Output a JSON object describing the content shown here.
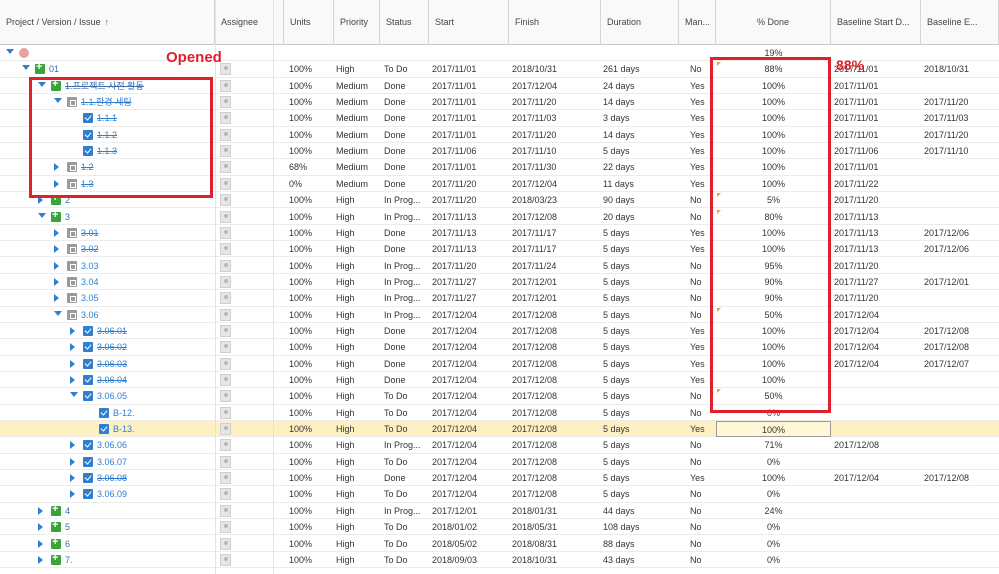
{
  "columns": [
    {
      "label": "Project / Version / Issue",
      "sort_icon": "↑"
    },
    {
      "label": "Assignee"
    },
    {
      "label": "Units"
    },
    {
      "label": "Priority"
    },
    {
      "label": "Status"
    },
    {
      "label": "Start"
    },
    {
      "label": "Finish"
    },
    {
      "label": "Duration"
    },
    {
      "label": "Man..."
    },
    {
      "label": "% Done"
    },
    {
      "label": "Baseline Start D..."
    },
    {
      "label": "Baseline E..."
    }
  ],
  "root_row": {
    "pct_done": "19%"
  },
  "rows": [
    {
      "name": "01",
      "done": false,
      "units": "100%",
      "priority": "High",
      "status": "To Do",
      "start": "2017/11/01",
      "finish": "2018/10/31",
      "duration": "261 days",
      "manual": "No",
      "pct": "88%",
      "bstart": "2017/11/01",
      "bend": "2018/10/31"
    },
    {
      "name": "1.프로젝트 사전 활동",
      "done": true,
      "units": "100%",
      "priority": "Medium",
      "status": "Done",
      "start": "2017/11/01",
      "finish": "2017/12/04",
      "duration": "24 days",
      "manual": "Yes",
      "pct": "100%",
      "bstart": "2017/11/01",
      "bend": ""
    },
    {
      "name": "1.1.환경 세팅",
      "done": true,
      "units": "100%",
      "priority": "Medium",
      "status": "Done",
      "start": "2017/11/01",
      "finish": "2017/11/20",
      "duration": "14 days",
      "manual": "Yes",
      "pct": "100%",
      "bstart": "2017/11/01",
      "bend": "2017/11/20"
    },
    {
      "name": "1.1.1",
      "done": true,
      "units": "100%",
      "priority": "Medium",
      "status": "Done",
      "start": "2017/11/01",
      "finish": "2017/11/03",
      "duration": "3 days",
      "manual": "Yes",
      "pct": "100%",
      "bstart": "2017/11/01",
      "bend": "2017/11/03"
    },
    {
      "name": "1.1.2",
      "done": true,
      "units": "100%",
      "priority": "Medium",
      "status": "Done",
      "start": "2017/11/01",
      "finish": "2017/11/20",
      "duration": "14 days",
      "manual": "Yes",
      "pct": "100%",
      "bstart": "2017/11/01",
      "bend": "2017/11/20"
    },
    {
      "name": "1.1.3",
      "done": true,
      "units": "100%",
      "priority": "Medium",
      "status": "Done",
      "start": "2017/11/06",
      "finish": "2017/11/10",
      "duration": "5 days",
      "manual": "Yes",
      "pct": "100%",
      "bstart": "2017/11/06",
      "bend": "2017/11/10"
    },
    {
      "name": "1.2",
      "done": true,
      "units": "68%",
      "priority": "Medium",
      "status": "Done",
      "start": "2017/11/01",
      "finish": "2017/11/30",
      "duration": "22 days",
      "manual": "Yes",
      "pct": "100%",
      "bstart": "2017/11/01",
      "bend": ""
    },
    {
      "name": "1.3",
      "done": true,
      "units": "0%",
      "priority": "Medium",
      "status": "Done",
      "start": "2017/11/20",
      "finish": "2017/12/04",
      "duration": "11 days",
      "manual": "Yes",
      "pct": "100%",
      "bstart": "2017/11/22",
      "bend": ""
    },
    {
      "name": "2",
      "done": false,
      "units": "100%",
      "priority": "High",
      "status": "In Prog...",
      "start": "2017/11/20",
      "finish": "2018/03/23",
      "duration": "90 days",
      "manual": "No",
      "pct": "5%",
      "bstart": "2017/11/20",
      "bend": ""
    },
    {
      "name": "3",
      "done": false,
      "units": "100%",
      "priority": "High",
      "status": "In Prog...",
      "start": "2017/11/13",
      "finish": "2017/12/08",
      "duration": "20 days",
      "manual": "No",
      "pct": "80%",
      "bstart": "2017/11/13",
      "bend": ""
    },
    {
      "name": "3.01",
      "done": true,
      "units": "100%",
      "priority": "High",
      "status": "Done",
      "start": "2017/11/13",
      "finish": "2017/11/17",
      "duration": "5 days",
      "manual": "Yes",
      "pct": "100%",
      "bstart": "2017/11/13",
      "bend": "2017/12/06"
    },
    {
      "name": "3.02",
      "done": true,
      "units": "100%",
      "priority": "High",
      "status": "Done",
      "start": "2017/11/13",
      "finish": "2017/11/17",
      "duration": "5 days",
      "manual": "Yes",
      "pct": "100%",
      "bstart": "2017/11/13",
      "bend": "2017/12/06"
    },
    {
      "name": "3.03",
      "done": false,
      "units": "100%",
      "priority": "High",
      "status": "In Prog...",
      "start": "2017/11/20",
      "finish": "2017/11/24",
      "duration": "5 days",
      "manual": "No",
      "pct": "95%",
      "bstart": "2017/11/20",
      "bend": ""
    },
    {
      "name": "3.04",
      "done": false,
      "units": "100%",
      "priority": "High",
      "status": "In Prog...",
      "start": "2017/11/27",
      "finish": "2017/12/01",
      "duration": "5 days",
      "manual": "No",
      "pct": "90%",
      "bstart": "2017/11/27",
      "bend": "2017/12/01"
    },
    {
      "name": "3.05",
      "done": false,
      "units": "100%",
      "priority": "High",
      "status": "In Prog...",
      "start": "2017/11/27",
      "finish": "2017/12/01",
      "duration": "5 days",
      "manual": "No",
      "pct": "90%",
      "bstart": "2017/11/20",
      "bend": ""
    },
    {
      "name": "3.06",
      "done": false,
      "units": "100%",
      "priority": "High",
      "status": "In Prog...",
      "start": "2017/12/04",
      "finish": "2017/12/08",
      "duration": "5 days",
      "manual": "No",
      "pct": "50%",
      "bstart": "2017/12/04",
      "bend": ""
    },
    {
      "name": "3.06.01",
      "done": true,
      "units": "100%",
      "priority": "High",
      "status": "Done",
      "start": "2017/12/04",
      "finish": "2017/12/08",
      "duration": "5 days",
      "manual": "Yes",
      "pct": "100%",
      "bstart": "2017/12/04",
      "bend": "2017/12/08"
    },
    {
      "name": "3.06.02",
      "done": true,
      "units": "100%",
      "priority": "High",
      "status": "Done",
      "start": "2017/12/04",
      "finish": "2017/12/08",
      "duration": "5 days",
      "manual": "Yes",
      "pct": "100%",
      "bstart": "2017/12/04",
      "bend": "2017/12/08"
    },
    {
      "name": "3.06.03",
      "done": true,
      "units": "100%",
      "priority": "High",
      "status": "Done",
      "start": "2017/12/04",
      "finish": "2017/12/08",
      "duration": "5 days",
      "manual": "Yes",
      "pct": "100%",
      "bstart": "2017/12/04",
      "bend": "2017/12/07"
    },
    {
      "name": "3.06.04",
      "done": true,
      "units": "100%",
      "priority": "High",
      "status": "Done",
      "start": "2017/12/04",
      "finish": "2017/12/08",
      "duration": "5 days",
      "manual": "Yes",
      "pct": "100%",
      "bstart": "",
      "bend": ""
    },
    {
      "name": "3.06.05",
      "done": false,
      "units": "100%",
      "priority": "High",
      "status": "To Do",
      "start": "2017/12/04",
      "finish": "2017/12/08",
      "duration": "5 days",
      "manual": "No",
      "pct": "50%",
      "bstart": "",
      "bend": ""
    },
    {
      "name": "B-12.",
      "done": false,
      "units": "100%",
      "priority": "High",
      "status": "To Do",
      "start": "2017/12/04",
      "finish": "2017/12/08",
      "duration": "5 days",
      "manual": "No",
      "pct": "0%",
      "bstart": "",
      "bend": ""
    },
    {
      "name": "B-13.",
      "done": false,
      "units": "100%",
      "priority": "High",
      "status": "To Do",
      "start": "2017/12/04",
      "finish": "2017/12/08",
      "duration": "5 days",
      "manual": "Yes",
      "pct": "100%",
      "bstart": "",
      "bend": ""
    },
    {
      "name": "3.06.06",
      "done": false,
      "units": "100%",
      "priority": "High",
      "status": "In Prog...",
      "start": "2017/12/04",
      "finish": "2017/12/08",
      "duration": "5 days",
      "manual": "No",
      "pct": "71%",
      "bstart": "2017/12/08",
      "bend": ""
    },
    {
      "name": "3.06.07",
      "done": false,
      "units": "100%",
      "priority": "High",
      "status": "To Do",
      "start": "2017/12/04",
      "finish": "2017/12/08",
      "duration": "5 days",
      "manual": "No",
      "pct": "0%",
      "bstart": "",
      "bend": ""
    },
    {
      "name": "3.06.08",
      "done": true,
      "units": "100%",
      "priority": "High",
      "status": "Done",
      "start": "2017/12/04",
      "finish": "2017/12/08",
      "duration": "5 days",
      "manual": "Yes",
      "pct": "100%",
      "bstart": "2017/12/04",
      "bend": "2017/12/08"
    },
    {
      "name": "3.06.09",
      "done": false,
      "units": "100%",
      "priority": "High",
      "status": "To Do",
      "start": "2017/12/04",
      "finish": "2017/12/08",
      "duration": "5 days",
      "manual": "No",
      "pct": "0%",
      "bstart": "",
      "bend": ""
    },
    {
      "name": "4",
      "done": false,
      "units": "100%",
      "priority": "High",
      "status": "In Prog...",
      "start": "2017/12/01",
      "finish": "2018/01/31",
      "duration": "44 days",
      "manual": "No",
      "pct": "24%",
      "bstart": "",
      "bend": ""
    },
    {
      "name": "5",
      "done": false,
      "units": "100%",
      "priority": "High",
      "status": "To Do",
      "start": "2018/01/02",
      "finish": "2018/05/31",
      "duration": "108 days",
      "manual": "No",
      "pct": "0%",
      "bstart": "",
      "bend": ""
    },
    {
      "name": "6",
      "done": false,
      "units": "100%",
      "priority": "High",
      "status": "To Do",
      "start": "2018/05/02",
      "finish": "2018/08/31",
      "duration": "88 days",
      "manual": "No",
      "pct": "0%",
      "bstart": "",
      "bend": ""
    },
    {
      "name": "7.",
      "done": false,
      "units": "100%",
      "priority": "High",
      "status": "To Do",
      "start": "2018/09/03",
      "finish": "2018/10/31",
      "duration": "43 days",
      "manual": "No",
      "pct": "0%",
      "bstart": "",
      "bend": ""
    }
  ],
  "annotations": {
    "opened": "Opened",
    "pct_callout": "88%"
  },
  "colors": {
    "annotation": "#e0202a",
    "selected_row": "#fdf0c2",
    "link": "#2f7fd1"
  }
}
